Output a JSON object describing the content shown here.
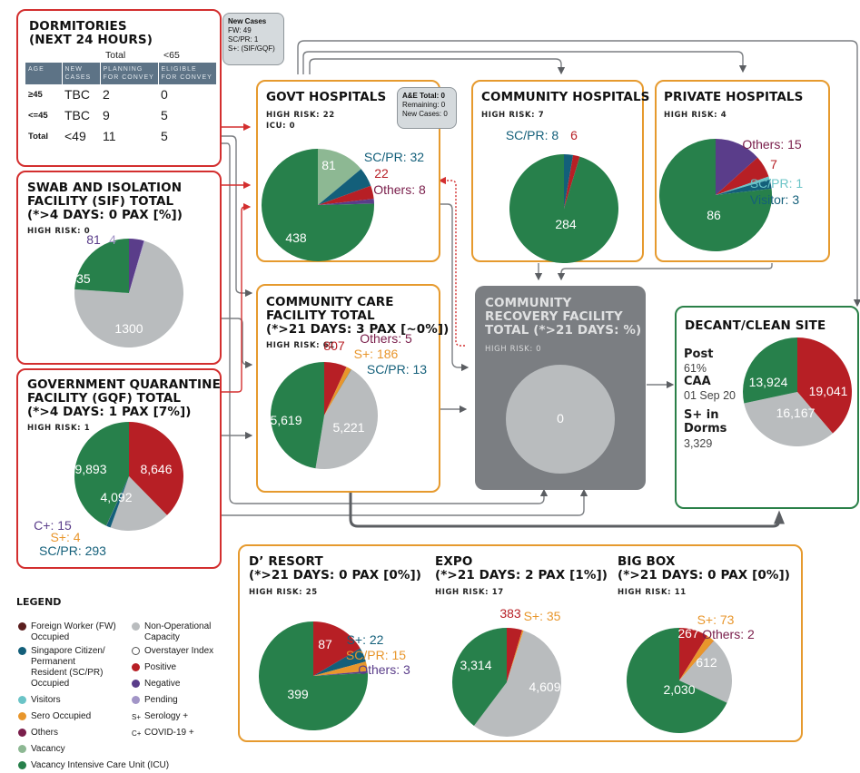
{
  "colors": {
    "fw": "#5a1e1e",
    "scpr": "#135f7a",
    "visitors": "#6bc4c7",
    "sero": "#e8962c",
    "others": "#7a1e4b",
    "vacancy": "#8db893",
    "vacancy_icu": "#27804b",
    "non_operational": "#b9bcbe",
    "positive": "#b71f25",
    "negative": "#5a3d8a",
    "pending": "#a295c7",
    "facility_box": "#e69a2e",
    "source_box": "#d32f2f",
    "decant_box": "#2a8048",
    "recovery_box": "#7b7e82"
  },
  "dormitories": {
    "title_line1": "DORMITORIES",
    "title_line2": "(NEXT 24 HOURS)",
    "sub_total": "Total",
    "sub_lt65": "<65",
    "headers": [
      "AGE",
      "NEW CASES",
      "PLANNING FOR CONVEY",
      "ELIGIBLE FOR CONVEY"
    ],
    "rows": [
      [
        "≥45",
        "TBC",
        "2",
        "0"
      ],
      [
        "<=45",
        "TBC",
        "9",
        "5"
      ],
      [
        "Total",
        "<49",
        "11",
        "5"
      ]
    ]
  },
  "new_cases_callout": {
    "title": "New Cases",
    "lines": [
      "FW: 49",
      "SC/PR: 1",
      "S+: (SIF/GQF)"
    ]
  },
  "ae_callout": {
    "lines": [
      "A&E Total: 0",
      "Remaining: 0",
      "New Cases: 0"
    ]
  },
  "decant": {
    "title": "DECANT/CLEAN SITE",
    "stats": [
      {
        "label": "Post",
        "value": "61%"
      },
      {
        "label": "CAA",
        "value": "01 Sep 20"
      },
      {
        "label": "S+ in Dorms",
        "value": "3,329"
      }
    ]
  },
  "legend": {
    "title": "LEGEND",
    "items": [
      {
        "label": "Foreign Worker (FW) Occupied",
        "color_key": "fw"
      },
      {
        "label": "Singapore Citizen/ Permanent Resident (SC/PR) Occupied",
        "color_key": "scpr"
      },
      {
        "label": "Visitors",
        "color_key": "visitors"
      },
      {
        "label": "Sero Occupied",
        "color_key": "sero"
      },
      {
        "label": "Others",
        "color_key": "others"
      },
      {
        "label": "Vacancy",
        "color_key": "vacancy"
      },
      {
        "label": "Vacancy Intensive Care Unit (ICU)",
        "color_key": "vacancy_icu"
      },
      {
        "label": "Non-Operational Capacity",
        "color_key": "non_operational"
      },
      {
        "label": "Overstayer Index",
        "color_key": "outline"
      },
      {
        "label": "Positive",
        "color_key": "positive"
      },
      {
        "label": "Negative",
        "color_key": "negative"
      },
      {
        "label": "Pending",
        "color_key": "pending"
      },
      {
        "label": "Serology +",
        "symbol": "S+"
      },
      {
        "label": "COVID-19 +",
        "symbol": "C+"
      }
    ]
  },
  "chart_data": [
    {
      "id": "sif",
      "type": "pie",
      "title": "SWAB AND ISOLATION FACILITY (SIF) TOTAL (*>4 DAYS: 0 PAX [%])",
      "title_lines": [
        "SWAB AND ISOLATION",
        "FACILITY (SIF) TOTAL",
        "(*>4 DAYS: 0 PAX [%])"
      ],
      "high_risk": "HIGH RISK: 0",
      "slices": [
        {
          "name": "Negative",
          "value": 81,
          "color": "#5a3d8a",
          "label": "81",
          "label_color": "#5a3d8a"
        },
        {
          "name": "Pending",
          "value": 4,
          "color": "#a295c7",
          "label": "4",
          "label_color": "#a295c7"
        },
        {
          "name": "Non-Operational Capacity",
          "value": 1300,
          "color": "#b9bcbe",
          "label": "1300",
          "label_color": "#ffffff"
        },
        {
          "name": "Vacancy ICU",
          "value": 435,
          "color": "#27804b",
          "label": "435",
          "label_color": "#ffffff"
        }
      ]
    },
    {
      "id": "gqf",
      "type": "pie",
      "title": "GOVERNMENT QUARANTINE FACILITY (GQF) TOTAL (*>4 DAYS: 1 PAX [7%])",
      "title_lines": [
        "GOVERNMENT QUARANTINE",
        "FACILITY (GQF) TOTAL",
        "(*>4 DAYS: 1 PAX [7%])"
      ],
      "high_risk": "HIGH RISK: 1",
      "slices": [
        {
          "name": "Positive",
          "value": 8646,
          "color": "#b71f25",
          "label": "8,646",
          "label_color": "#ffffff"
        },
        {
          "name": "Non-Operational Capacity",
          "value": 4092,
          "color": "#b9bcbe",
          "label": "4,092",
          "label_color": "#ffffff"
        },
        {
          "name": "SC/PR",
          "value": 293,
          "color": "#135f7a",
          "label": "SC/PR: 293",
          "label_color": "#135f7a"
        },
        {
          "name": "S+",
          "value": 4,
          "color": "#e8962c",
          "label": "S+: 4",
          "label_color": "#e8962c"
        },
        {
          "name": "C+",
          "value": 15,
          "color": "#5a3d8a",
          "label": "C+: 15",
          "label_color": "#5a3d8a"
        },
        {
          "name": "Vacancy ICU",
          "value": 9893,
          "color": "#27804b",
          "label": "9,893",
          "label_color": "#ffffff"
        }
      ]
    },
    {
      "id": "govt",
      "type": "pie",
      "title": "GOVT HOSPITALS",
      "title_lines": [
        "GOVT HOSPITALS"
      ],
      "high_risk": "HIGH RISK: 22",
      "icu": "ICU: 0",
      "slices": [
        {
          "name": "Vacancy",
          "value": 81,
          "color": "#8db893",
          "label": "81",
          "label_color": "#ffffff"
        },
        {
          "name": "SC/PR",
          "value": 32,
          "color": "#135f7a",
          "label": "SC/PR: 32",
          "label_color": "#135f7a"
        },
        {
          "name": "Positive",
          "value": 22,
          "color": "#b71f25",
          "label": "22",
          "label_color": "#b71f25"
        },
        {
          "name": "Others",
          "value": 8,
          "color": "#5a3d8a",
          "label": "Others: 8",
          "label_color": "#7a1e4b"
        },
        {
          "name": "Vacancy ICU",
          "value": 438,
          "color": "#27804b",
          "label": "438",
          "label_color": "#ffffff"
        }
      ]
    },
    {
      "id": "community_hosp",
      "type": "pie",
      "title": "COMMUNITY HOSPITALS",
      "title_lines": [
        "COMMUNITY HOSPITALS"
      ],
      "high_risk": "HIGH RISK: 7",
      "slices": [
        {
          "name": "SC/PR",
          "value": 8,
          "color": "#135f7a",
          "label": "SC/PR: 8",
          "label_color": "#135f7a"
        },
        {
          "name": "Positive",
          "value": 6,
          "color": "#b71f25",
          "label": "6",
          "label_color": "#b71f25"
        },
        {
          "name": "Vacancy ICU",
          "value": 284,
          "color": "#27804b",
          "label": "284",
          "label_color": "#ffffff"
        }
      ]
    },
    {
      "id": "private_hosp",
      "type": "pie",
      "title": "PRIVATE HOSPITALS",
      "title_lines": [
        "PRIVATE HOSPITALS"
      ],
      "high_risk": "HIGH RISK: 4",
      "slices": [
        {
          "name": "Others",
          "value": 15,
          "color": "#5a3d8a",
          "label": "Others: 15",
          "label_color": "#7a1e4b"
        },
        {
          "name": "Positive",
          "value": 7,
          "color": "#b71f25",
          "label": "7",
          "label_color": "#b71f25"
        },
        {
          "name": "SC/PR",
          "value": 1,
          "color": "#6bc4c7",
          "label": "SC/PR: 1",
          "label_color": "#6bc4c7"
        },
        {
          "name": "Visitor",
          "value": 3,
          "color": "#135f7a",
          "label": "Visitor: 3",
          "label_color": "#135f7a"
        },
        {
          "name": "Vacancy ICU",
          "value": 86,
          "color": "#27804b",
          "label": "86",
          "label_color": "#ffffff"
        }
      ]
    },
    {
      "id": "ccf",
      "type": "pie",
      "title": "COMMUNITY CARE FACILITY TOTAL (*>21 DAYS: 3 PAX [~0%])",
      "title_lines": [
        "COMMUNITY CARE",
        "FACILITY TOTAL",
        "(*>21 DAYS: 3 PAX [~0%])"
      ],
      "high_risk": "HIGH RISK: 61",
      "slices": [
        {
          "name": "Positive",
          "value": 807,
          "color": "#b71f25",
          "label": "807",
          "label_color": "#b71f25"
        },
        {
          "name": "Others",
          "value": 5,
          "color": "#7a1e4b",
          "label": "Others: 5",
          "label_color": "#7a1e4b"
        },
        {
          "name": "S+",
          "value": 186,
          "color": "#e8962c",
          "label": "S+: 186",
          "label_color": "#e8962c"
        },
        {
          "name": "SC/PR",
          "value": 13,
          "color": "#135f7a",
          "label": "SC/PR: 13",
          "label_color": "#135f7a"
        },
        {
          "name": "Non-Operational Capacity",
          "value": 5221,
          "color": "#b9bcbe",
          "label": "5,221",
          "label_color": "#ffffff"
        },
        {
          "name": "Vacancy ICU",
          "value": 5619,
          "color": "#27804b",
          "label": "5,619",
          "label_color": "#ffffff"
        }
      ]
    },
    {
      "id": "crf",
      "type": "pie",
      "title": "COMMUNITY RECOVERY FACILITY TOTAL (*>21 DAYS: %)",
      "title_lines": [
        "COMMUNITY",
        "RECOVERY FACILITY",
        "TOTAL (*>21 DAYS: %)"
      ],
      "high_risk": "HIGH RISK: 0",
      "slices": [
        {
          "name": "Empty",
          "value": 0,
          "color": "#b9bcbe",
          "label": "0",
          "label_color": "#ffffff"
        }
      ]
    },
    {
      "id": "decant_pie",
      "type": "pie",
      "title": "DECANT/CLEAN SITE",
      "slices": [
        {
          "name": "Positive",
          "value": 19041,
          "color": "#b71f25",
          "label": "19,041",
          "label_color": "#ffffff"
        },
        {
          "name": "Non-Operational Capacity",
          "value": 16167,
          "color": "#b9bcbe",
          "label": "16,167",
          "label_color": "#ffffff"
        },
        {
          "name": "Vacancy ICU",
          "value": 13924,
          "color": "#27804b",
          "label": "13,924",
          "label_color": "#ffffff"
        }
      ]
    },
    {
      "id": "dresort",
      "type": "pie",
      "title": "D' RESORT (*>21 DAYS: 0 PAX [0%])",
      "title_lines": [
        "D’ RESORT",
        "(*>21 DAYS: 0 PAX [0%])"
      ],
      "high_risk": "HIGH RISK: 25",
      "slices": [
        {
          "name": "Positive",
          "value": 87,
          "color": "#b71f25",
          "label": "87",
          "label_color": "#ffffff"
        },
        {
          "name": "S+",
          "value": 22,
          "color": "#135f7a",
          "label": "S+: 22",
          "label_color": "#135f7a"
        },
        {
          "name": "SC/PR",
          "value": 15,
          "color": "#e8962c",
          "label": "SC/PR: 15",
          "label_color": "#e8962c"
        },
        {
          "name": "Others",
          "value": 3,
          "color": "#5a3d8a",
          "label": "Others: 3",
          "label_color": "#5a3d8a"
        },
        {
          "name": "Vacancy ICU",
          "value": 399,
          "color": "#27804b",
          "label": "399",
          "label_color": "#ffffff"
        }
      ]
    },
    {
      "id": "expo",
      "type": "pie",
      "title": "EXPO (*>21 DAYS: 2 PAX [1%])",
      "title_lines": [
        "EXPO",
        "(*>21 DAYS: 2 PAX [1%])"
      ],
      "high_risk": "HIGH RISK: 17",
      "slices": [
        {
          "name": "Positive",
          "value": 383,
          "color": "#b71f25",
          "label": "383",
          "label_color": "#b71f25"
        },
        {
          "name": "S+",
          "value": 35,
          "color": "#e8962c",
          "label": "S+: 35",
          "label_color": "#e8962c"
        },
        {
          "name": "Non-Operational Capacity",
          "value": 4609,
          "color": "#b9bcbe",
          "label": "4,609",
          "label_color": "#ffffff"
        },
        {
          "name": "Vacancy ICU",
          "value": 3314,
          "color": "#27804b",
          "label": "3,314",
          "label_color": "#ffffff"
        }
      ]
    },
    {
      "id": "bigbox",
      "type": "pie",
      "title": "BIG BOX (*>21 DAYS: 0 PAX [0%])",
      "title_lines": [
        "BIG BOX",
        "(*>21 DAYS: 0 PAX [0%])"
      ],
      "high_risk": "HIGH RISK: 11",
      "slices": [
        {
          "name": "Positive",
          "value": 267,
          "color": "#b71f25",
          "label": "267",
          "label_color": "#ffffff"
        },
        {
          "name": "S+",
          "value": 73,
          "color": "#e8962c",
          "label": "S+: 73",
          "label_color": "#e8962c"
        },
        {
          "name": "Others",
          "value": 2,
          "color": "#7a1e4b",
          "label": "Others: 2",
          "label_color": "#7a1e4b"
        },
        {
          "name": "Non-Operational Capacity",
          "value": 612,
          "color": "#b9bcbe",
          "label": "612",
          "label_color": "#ffffff"
        },
        {
          "name": "Vacancy ICU",
          "value": 2030,
          "color": "#27804b",
          "label": "2,030",
          "label_color": "#ffffff"
        }
      ]
    }
  ]
}
